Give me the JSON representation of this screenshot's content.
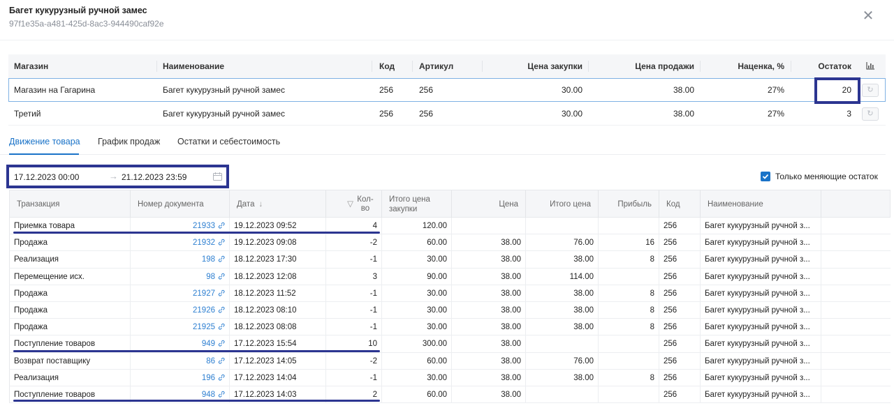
{
  "header": {
    "title": "Багет кукурузный ручной замес",
    "id": "97f1e35a-a481-425d-8ac3-944490caf92e",
    "close_icon": "close-icon"
  },
  "stores": {
    "columns": [
      "Магазин",
      "Наименование",
      "Код",
      "Артикул",
      "Цена закупки",
      "Цена продажи",
      "Наценка, %",
      "Остаток"
    ],
    "rows": [
      {
        "store": "Магазин на Гагарина",
        "name": "Багет кукурузный ручной замес",
        "code": "256",
        "article": "256",
        "buy": "30.00",
        "sell": "38.00",
        "markup": "27%",
        "stock": "20"
      },
      {
        "store": "Третий",
        "name": "Багет кукурузный ручной замес",
        "code": "256",
        "article": "256",
        "buy": "30.00",
        "sell": "38.00",
        "markup": "27%",
        "stock": "3"
      }
    ]
  },
  "tabs": [
    "Движение товара",
    "График продаж",
    "Остатки и себестоимость"
  ],
  "filters": {
    "date_from": "17.12.2023 00:00",
    "date_to": "21.12.2023 23:59",
    "only_changing_label": "Только меняющие остаток",
    "only_changing_checked": true
  },
  "moves": {
    "columns": {
      "transaction": "Транзакция",
      "doc": "Номер документа",
      "date": "Дата",
      "qty": "Кол-во",
      "total_buy": "Итого цена закупки",
      "price": "Цена",
      "total_price": "Итого цена",
      "profit": "Прибыль",
      "code": "Код",
      "name": "Наименование"
    },
    "rows": [
      {
        "t": "Приемка товара",
        "doc": "21933",
        "date": "19.12.2023 09:52",
        "qty": "4",
        "tb": "120.00",
        "price": "",
        "tp": "",
        "profit": "",
        "code": "256",
        "name": "Багет кукурузный ручной з..."
      },
      {
        "t": "Продажа",
        "doc": "21932",
        "date": "19.12.2023 09:08",
        "qty": "-2",
        "tb": "60.00",
        "price": "38.00",
        "tp": "76.00",
        "profit": "16",
        "code": "256",
        "name": "Багет кукурузный ручной з..."
      },
      {
        "t": "Реализация",
        "doc": "198",
        "date": "18.12.2023 17:30",
        "qty": "-1",
        "tb": "30.00",
        "price": "38.00",
        "tp": "38.00",
        "profit": "8",
        "code": "256",
        "name": "Багет кукурузный ручной з..."
      },
      {
        "t": "Перемещение исх.",
        "doc": "98",
        "date": "18.12.2023 12:08",
        "qty": "3",
        "tb": "90.00",
        "price": "38.00",
        "tp": "114.00",
        "profit": "",
        "code": "256",
        "name": "Багет кукурузный ручной з..."
      },
      {
        "t": "Продажа",
        "doc": "21927",
        "date": "18.12.2023 11:52",
        "qty": "-1",
        "tb": "30.00",
        "price": "38.00",
        "tp": "38.00",
        "profit": "8",
        "code": "256",
        "name": "Багет кукурузный ручной з..."
      },
      {
        "t": "Продажа",
        "doc": "21926",
        "date": "18.12.2023 08:10",
        "qty": "-1",
        "tb": "30.00",
        "price": "38.00",
        "tp": "38.00",
        "profit": "8",
        "code": "256",
        "name": "Багет кукурузный ручной з..."
      },
      {
        "t": "Продажа",
        "doc": "21925",
        "date": "18.12.2023 08:08",
        "qty": "-1",
        "tb": "30.00",
        "price": "38.00",
        "tp": "38.00",
        "profit": "8",
        "code": "256",
        "name": "Багет кукурузный ручной з..."
      },
      {
        "t": "Поступление товаров",
        "doc": "949",
        "date": "17.12.2023 15:54",
        "qty": "10",
        "tb": "300.00",
        "price": "38.00",
        "tp": "",
        "profit": "",
        "code": "256",
        "name": "Багет кукурузный ручной з..."
      },
      {
        "t": "Возврат поставщику",
        "doc": "86",
        "date": "17.12.2023 14:05",
        "qty": "-2",
        "tb": "60.00",
        "price": "38.00",
        "tp": "76.00",
        "profit": "",
        "code": "256",
        "name": "Багет кукурузный ручной з..."
      },
      {
        "t": "Реализация",
        "doc": "196",
        "date": "17.12.2023 14:04",
        "qty": "-1",
        "tb": "30.00",
        "price": "38.00",
        "tp": "38.00",
        "profit": "8",
        "code": "256",
        "name": "Багет кукурузный ручной з..."
      },
      {
        "t": "Поступление товаров",
        "doc": "948",
        "date": "17.12.2023 14:03",
        "qty": "2",
        "tb": "60.00",
        "price": "38.00",
        "tp": "",
        "profit": "",
        "code": "256",
        "name": "Багет кукурузный ручной з..."
      }
    ]
  },
  "colors": {
    "accent": "#1a73c8",
    "annotation": "#2c3591"
  }
}
